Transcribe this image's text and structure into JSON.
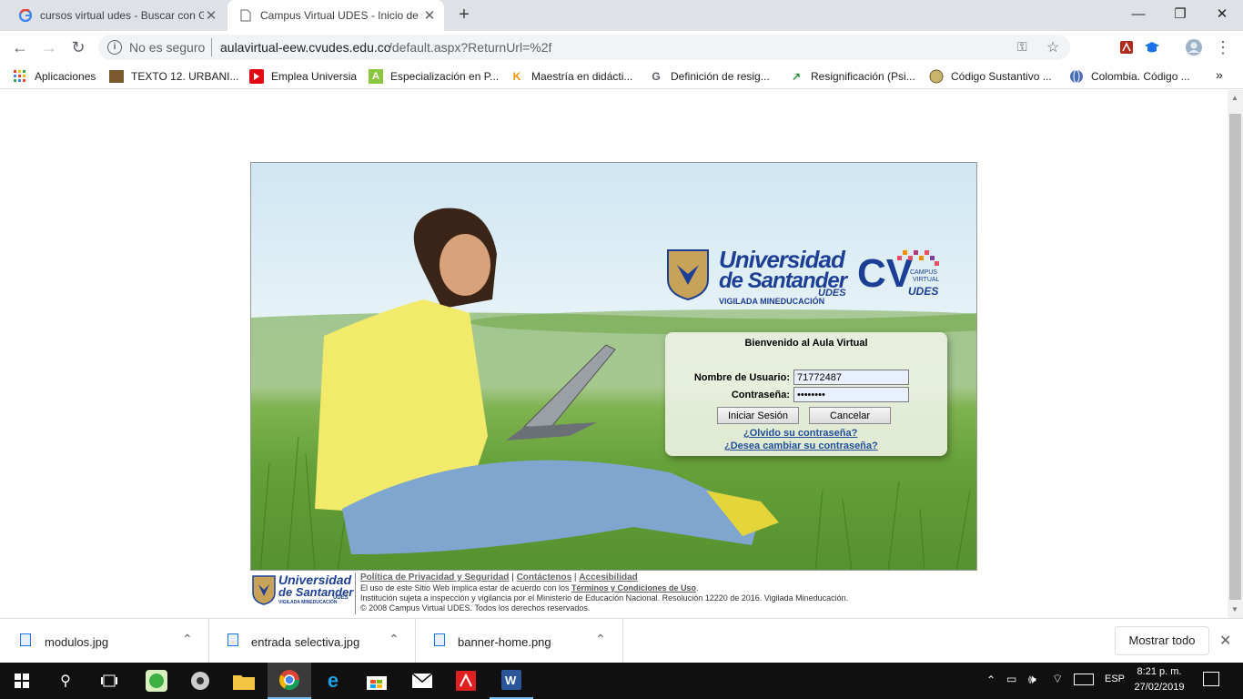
{
  "tabs": [
    {
      "title": "cursos virtual udes - Buscar con G",
      "active": false
    },
    {
      "title": "Campus Virtual UDES - Inicio de s",
      "active": true
    }
  ],
  "omnibox": {
    "security": "No es seguro",
    "url_host": "aulavirtual-eew.cvudes.edu.co",
    "url_path": "/default.aspx?ReturnUrl=%2f"
  },
  "bookmarks": [
    {
      "label": "Aplicaciones",
      "icon": "apps-grid-icon"
    },
    {
      "label": "TEXTO 12. URBANI...",
      "icon": "book-icon"
    },
    {
      "label": "Emplea Universia",
      "icon": "universia-icon"
    },
    {
      "label": "Especialización en P...",
      "icon": "green-a-icon"
    },
    {
      "label": "Maestría en didácti...",
      "icon": "wk-icon"
    },
    {
      "label": "Definición de resig...",
      "icon": "google-translate-icon"
    },
    {
      "label": "Resignificación (Psi...",
      "icon": "arrow-logo-icon"
    },
    {
      "label": "Código Sustantivo ...",
      "icon": "seal-icon"
    },
    {
      "label": "Colombia. Código ...",
      "icon": "globe-icon"
    }
  ],
  "logo": {
    "line1": "Universidad",
    "line2": "de Santander",
    "suffix": "UDES",
    "tagline": "VIGILADA MINEDUCACIÓN",
    "cv": "CV",
    "cv_small1": "CAMPUS",
    "cv_small2": "VIRTUAL",
    "cv_small3": "UDES"
  },
  "login": {
    "welcome": "Bienvenido al Aula Virtual",
    "user_label": "Nombre de Usuario:",
    "user_value": "71772487",
    "pass_label": "Contraseña:",
    "pass_value": "••••••••",
    "login_button": "Iniciar Sesión",
    "cancel_button": "Cancelar",
    "forgot_link": "¿Olvido su contraseña?",
    "change_link": "¿Desea cambiar su contraseña?"
  },
  "footer": {
    "link1": "Política de Privacidad y Seguridad",
    "sep": "|",
    "link2": "Contáctenos",
    "link3": "Accesibilidad",
    "line2_pre": "El uso de este Sitio Web implica estar de acuerdo con los ",
    "line2_link": "Términos y Condiciones de Uso",
    "line2_post": ".",
    "line3": "Institución sujeta a inspección y vigilancia por el Ministerio de Educación Nacional. Resolución 12220 de 2016. Vigilada Mineducación.",
    "line4": "© 2008 Campus Virtual UDES. Todos los derechos reservados."
  },
  "downloads": [
    {
      "name": "modulos.jpg"
    },
    {
      "name": "entrada selectiva.jpg"
    },
    {
      "name": "banner-home.png"
    }
  ],
  "show_all": "Mostrar todo",
  "taskbar": {
    "lang": "ESP",
    "time": "8:21 p. m.",
    "date": "27/02/2019"
  },
  "colors": {
    "udes_blue": "#1c3f95",
    "chrome_tabbar": "#dee1e6",
    "taskbar": "#101010"
  }
}
